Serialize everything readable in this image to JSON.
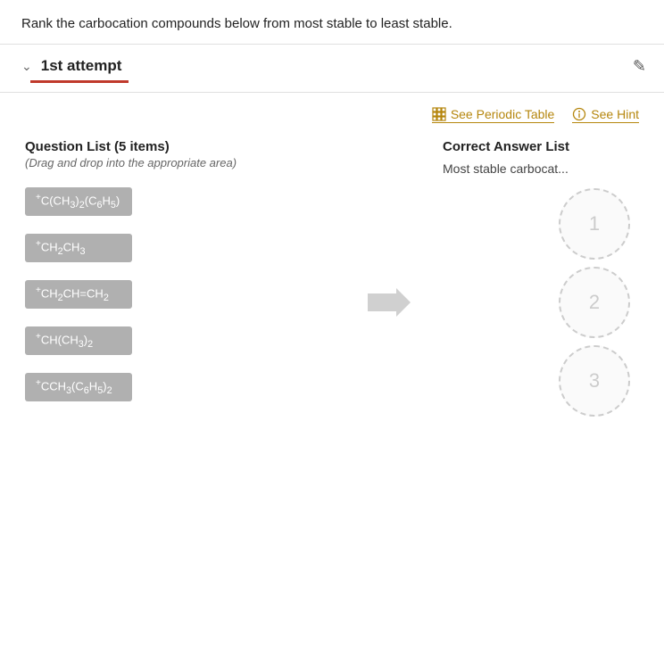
{
  "instruction": "Rank the carbocation compounds below from most stable to least stable.",
  "attempt": {
    "label": "1st attempt"
  },
  "toolbar": {
    "periodic_table_label": "See Periodic Table",
    "hint_label": "See Hint"
  },
  "question_list": {
    "title": "Question List (5 items)",
    "subtitle": "(Drag and drop into the appropriate area)",
    "items": [
      {
        "id": "c1",
        "formula_html": "<sup>+</sup>C(CH<sub>3</sub>)<sub>2</sub>(C<sub>6</sub>H<sub>5</sub>)"
      },
      {
        "id": "c2",
        "formula_html": "<sup>+</sup>CH<sub>2</sub>CH<sub>3</sub>"
      },
      {
        "id": "c3",
        "formula_html": "<sup>+</sup>CH<sub>2</sub>CH=CH<sub>2</sub>"
      },
      {
        "id": "c4",
        "formula_html": "<sup>+</sup>CH(CH<sub>3</sub>)<sub>2</sub>"
      },
      {
        "id": "c5",
        "formula_html": "<sup>+</sup>CCH<sub>3</sub>(C<sub>6</sub>H<sub>5</sub>)<sub>2</sub>"
      }
    ]
  },
  "correct_answer": {
    "title": "Correct Answer List",
    "most_stable_label": "Most stable carbocat...",
    "drop_zones": [
      {
        "number": "1"
      },
      {
        "number": "2"
      },
      {
        "number": "3"
      }
    ]
  }
}
